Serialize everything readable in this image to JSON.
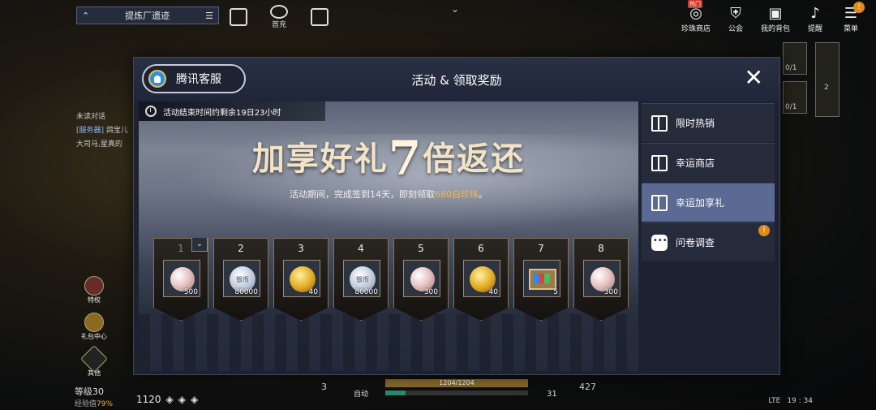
{
  "hud": {
    "quest_label": "提炼厂遗迹",
    "top_icons": [
      {
        "name": "gift-icon",
        "label": ""
      },
      {
        "name": "first-recharge-icon",
        "label": "首充"
      },
      {
        "name": "book-icon",
        "label": ""
      }
    ],
    "right_menu": [
      {
        "name": "pearl-shop",
        "label": "珍珠商店",
        "tag": "热门",
        "badge": ""
      },
      {
        "name": "guild",
        "label": "公会",
        "tag": "",
        "badge": ""
      },
      {
        "name": "my-bag",
        "label": "我的背包",
        "tag": "",
        "badge": ""
      },
      {
        "name": "reminder",
        "label": "提醒",
        "tag": "",
        "badge": ""
      },
      {
        "name": "menu",
        "label": "菜单",
        "tag": "",
        "badge": "!"
      }
    ],
    "chat_title": "未读对话",
    "chat_server_tag": "[服务器]",
    "chat_server_text": "鸽宝儿",
    "chat_line2": "大司马,星真的",
    "side_buttons": [
      {
        "name": "privilege",
        "label": "特权"
      },
      {
        "name": "gift-center",
        "label": "礼包中心"
      },
      {
        "name": "other",
        "label": "其他"
      }
    ],
    "level_text": "等级30",
    "exp_label": "经验值",
    "exp_pct": "79%",
    "combat_power": "1120",
    "hp_text": "1204/1204",
    "mp_fill": 0.14,
    "auto_label": "自动",
    "num_left": "3",
    "num_mid": "31",
    "num_right": "427",
    "net": "LTE",
    "clock": "19 : 34",
    "slot_a": "0/1",
    "slot_b": "0/1",
    "slot_c": "2"
  },
  "modal": {
    "cs_label": "腾讯客服",
    "title": "活动 & 领取奖励",
    "close": "✕",
    "timer": "活动结束时间约剩余19日23小时",
    "headline_a": "加享好礼",
    "headline_7": "7",
    "headline_b": "倍返还",
    "sub_a": "活动期间，完成签到14天，即刻领取",
    "sub_hl": "680白珍珠",
    "sub_b": "。",
    "rewards": [
      {
        "day": "1",
        "type": "pearl",
        "qty": "500",
        "done": true,
        "coin_text": ""
      },
      {
        "day": "2",
        "type": "silver",
        "qty": "80000",
        "done": false,
        "coin_text": "银币"
      },
      {
        "day": "3",
        "type": "gold",
        "qty": "40",
        "done": false,
        "coin_text": ""
      },
      {
        "day": "4",
        "type": "silver",
        "qty": "80000",
        "done": false,
        "coin_text": "银币"
      },
      {
        "day": "5",
        "type": "pearl",
        "qty": "300",
        "done": false,
        "coin_text": ""
      },
      {
        "day": "6",
        "type": "gold",
        "qty": "40",
        "done": false,
        "coin_text": ""
      },
      {
        "day": "7",
        "type": "box",
        "qty": "5",
        "done": false,
        "coin_text": ""
      },
      {
        "day": "8",
        "type": "pearl",
        "qty": "300",
        "done": false,
        "coin_text": ""
      }
    ],
    "tabs": [
      {
        "label": "限时热销",
        "icon": "gift",
        "active": false,
        "badge": ""
      },
      {
        "label": "幸运商店",
        "icon": "gift",
        "active": false,
        "badge": ""
      },
      {
        "label": "幸运加享礼",
        "icon": "gift",
        "active": true,
        "badge": ""
      },
      {
        "label": "问卷调查",
        "icon": "chat",
        "active": false,
        "badge": "!"
      }
    ]
  }
}
